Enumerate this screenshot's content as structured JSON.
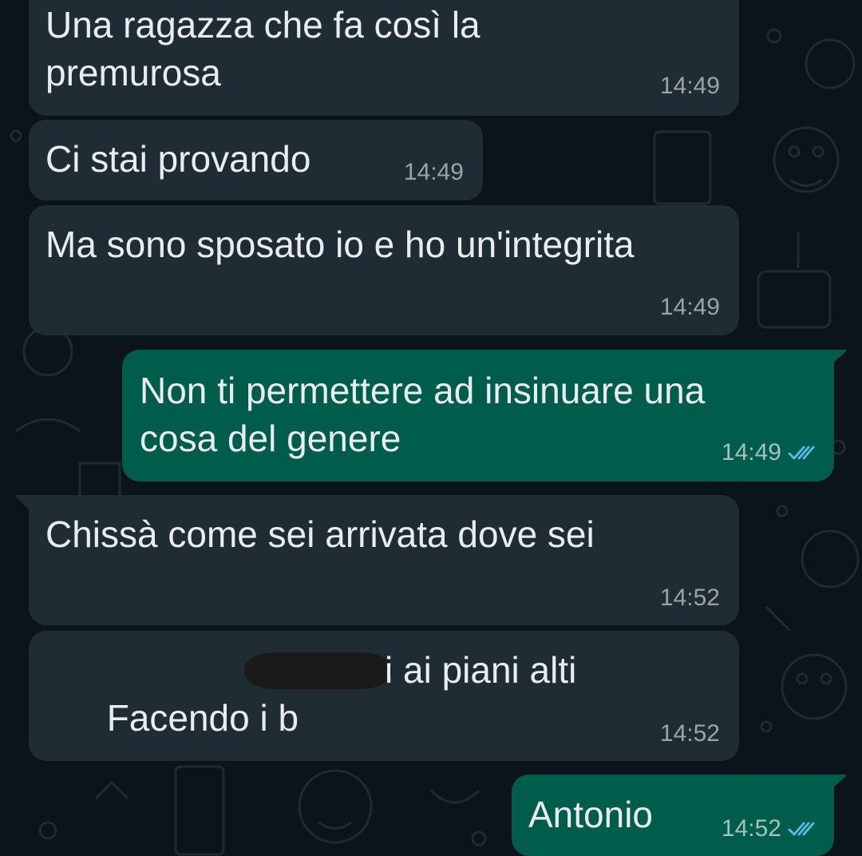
{
  "messages": [
    {
      "direction": "in",
      "text": "Una ragazza che fa così la\npremurosa",
      "time": "14:49"
    },
    {
      "direction": "in",
      "text": "Ci stai provando",
      "time": "14:49"
    },
    {
      "direction": "in",
      "text": "Ma sono sposato io e ho un'integrita",
      "time": "14:49"
    },
    {
      "direction": "out",
      "text": "Non ti permettere ad insinuare una\ncosa del genere",
      "time": "14:49",
      "status": "read"
    },
    {
      "direction": "in",
      "text": "Chissà come sei arrivata dove sei",
      "time": "14:52"
    },
    {
      "direction": "in",
      "text_before": "Facendo i b",
      "text_after": "i ai piani alti",
      "time": "14:52",
      "redacted": true
    },
    {
      "direction": "out",
      "text": "Antonio",
      "time": "14:52",
      "status": "read"
    }
  ],
  "colors": {
    "background": "#0b141a",
    "incoming_bubble": "#202c33",
    "outgoing_bubble": "#005c4b",
    "read_ticks": "#53bdeb"
  },
  "icons": {
    "read_status": "double-check-icon"
  }
}
